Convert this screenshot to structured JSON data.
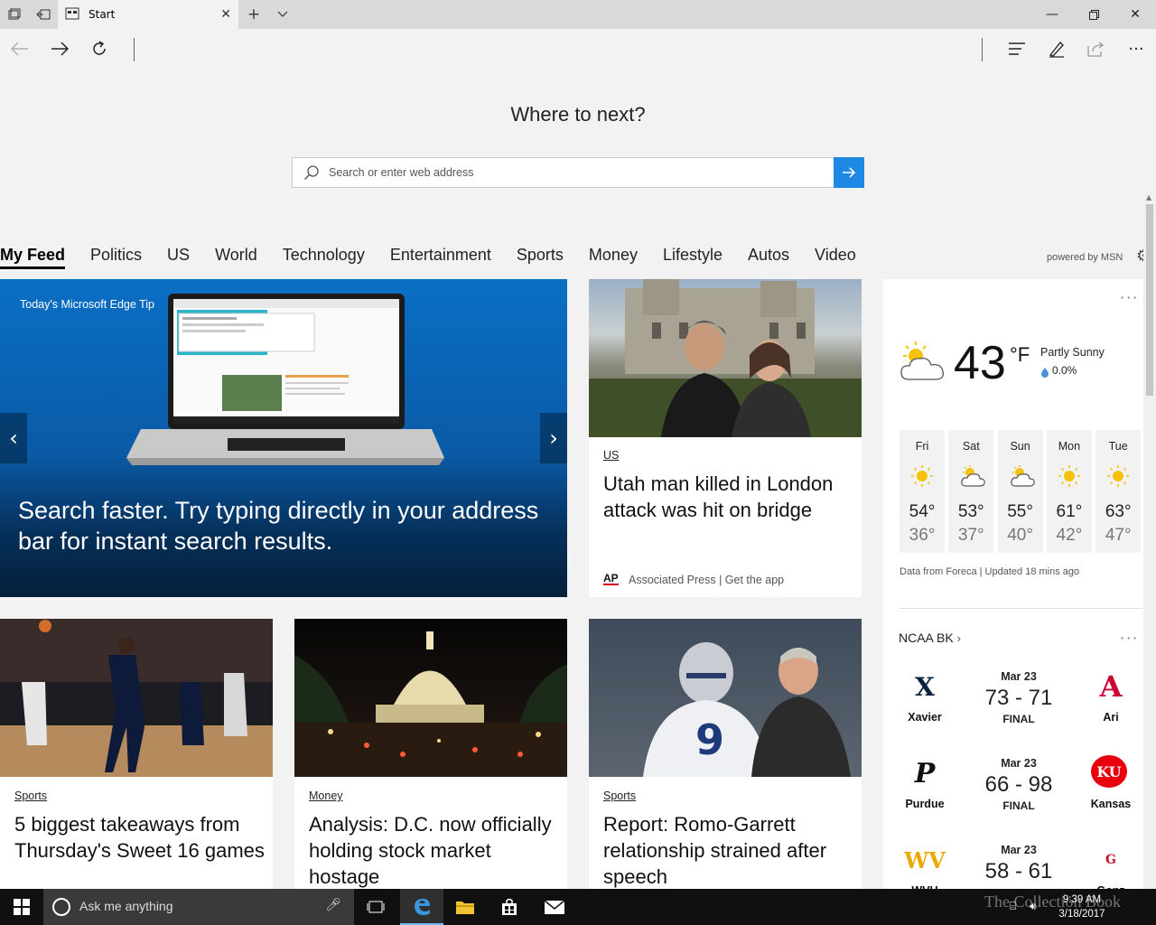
{
  "browser": {
    "tab_title": "Start",
    "hero_question": "Where to next?",
    "search_placeholder": "Search or enter web address"
  },
  "categories": [
    "My Feed",
    "Politics",
    "US",
    "World",
    "Technology",
    "Entertainment",
    "Sports",
    "Money",
    "Lifestyle",
    "Autos",
    "Video"
  ],
  "powered_by": "powered by MSN",
  "hero_card": {
    "label": "Today's Microsoft Edge Tip",
    "title": "Search faster. Try typing directly in your address bar for instant search results.",
    "dot_count": 14,
    "active_dot": 1
  },
  "top_story": {
    "category": "US",
    "headline": "Utah man killed in London attack was hit on bridge",
    "source_logo": "AP",
    "source": "Associated Press",
    "get_app": "| Get the app"
  },
  "stories": [
    {
      "category": "Sports",
      "headline": "5 biggest takeaways from Thursday's Sweet 16 games"
    },
    {
      "category": "Money",
      "headline": "Analysis: D.C. now officially holding stock market hostage"
    },
    {
      "category": "Sports",
      "headline": "Report: Romo-Garrett relationship strained after speech"
    }
  ],
  "weather": {
    "temp": "43",
    "unit": "°F",
    "condition": "Partly Sunny",
    "precip": "0.0%",
    "forecast": [
      {
        "day": "Fri",
        "hi": "54°",
        "lo": "36°",
        "icon": "sun-icon"
      },
      {
        "day": "Sat",
        "hi": "53°",
        "lo": "37°",
        "icon": "partly-cloudy-icon"
      },
      {
        "day": "Sun",
        "hi": "55°",
        "lo": "40°",
        "icon": "partly-cloudy-icon"
      },
      {
        "day": "Mon",
        "hi": "61°",
        "lo": "42°",
        "icon": "sun-icon"
      },
      {
        "day": "Tue",
        "hi": "63°",
        "lo": "47°",
        "icon": "sun-icon"
      }
    ],
    "footer": "Data from Foreca | Updated 18 mins ago"
  },
  "ncaa": {
    "title": "NCAA BK",
    "games": [
      {
        "date": "Mar 23",
        "score": "73 - 71",
        "status": "FINAL",
        "home": "Xavier",
        "home_logo": "X",
        "away": "Ari",
        "away_logo": "A"
      },
      {
        "date": "Mar 23",
        "score": "66 - 98",
        "status": "FINAL",
        "home": "Purdue",
        "home_logo": "P",
        "away": "Kansas",
        "away_logo": "KU"
      },
      {
        "date": "Mar 23",
        "score": "58 - 61",
        "status": "",
        "home": "WVU",
        "home_logo": "WV",
        "away": "Gonz",
        "away_logo": "G"
      }
    ]
  },
  "taskbar": {
    "search_text": "Ask me anything",
    "time": "9:39 AM",
    "date": "3/18/2017"
  },
  "watermark": "The Collection Book",
  "colors": {
    "accent": "#1e88e5",
    "ap_red": "#d0021b"
  }
}
